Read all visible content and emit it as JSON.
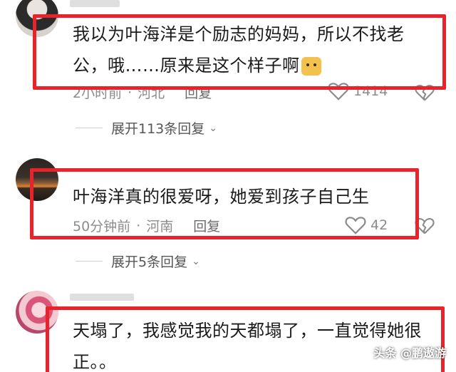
{
  "comments": [
    {
      "text_line1": "我以为叶海洋是个励志的妈妈，所以不找老",
      "text_line2": "公，哦……原来是这个样子啊",
      "emoji": "cat-emoji",
      "time": "2小时前",
      "location": "河北",
      "reply_label": "回复",
      "likes": "1414",
      "expand_label": "展开113条回复"
    },
    {
      "text_line1": "叶海洋真的很爱呀，她爱到孩子自己生",
      "time": "50分钟前",
      "location": "河南",
      "reply_label": "回复",
      "likes": "42",
      "expand_label": "展开5条回复"
    },
    {
      "text_line1": "天塌了，我感觉我的天都塌了，一直觉得她很",
      "text_line2": "正。。"
    }
  ],
  "watermark": "头条 @鹏遨游",
  "icons": {
    "like": "heart-icon",
    "dislike": "broken-heart-icon",
    "expand": "chevron-down-icon"
  },
  "colors": {
    "highlight_box": "#e8232b",
    "meta_text": "#8c8c8c"
  }
}
